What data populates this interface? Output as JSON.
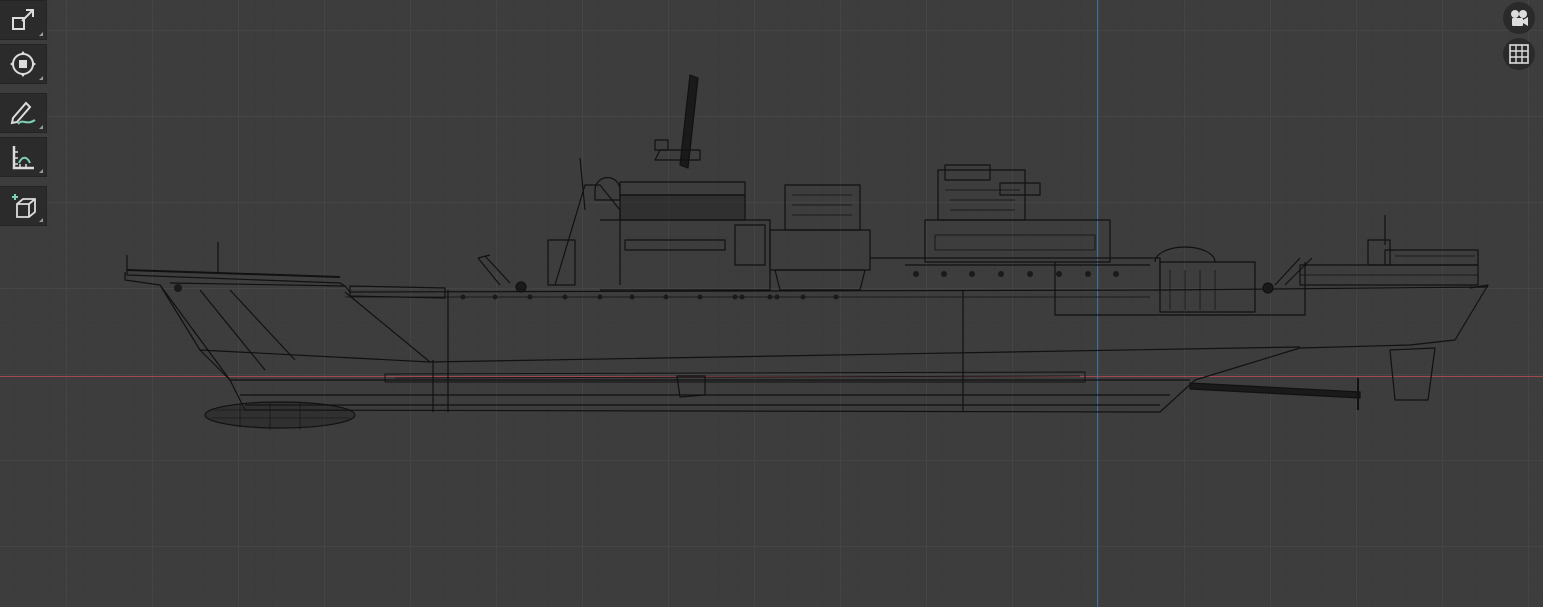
{
  "viewport": {
    "background_color": "#3d3d3d",
    "axis_x_color": "#b44a55",
    "axis_z_color": "#3d74b3",
    "wire_color": "#111111",
    "object": "ship-wireframe-side-view"
  },
  "toolbar": {
    "tools": [
      {
        "name": "scale-tool",
        "icon": "scale-icon"
      },
      {
        "name": "transform-tool",
        "icon": "transform-icon"
      },
      {
        "name": "annotate-tool",
        "icon": "annotate-pencil-icon"
      },
      {
        "name": "measure-tool",
        "icon": "ruler-icon"
      },
      {
        "name": "add-cube-tool",
        "icon": "add-cube-icon"
      }
    ]
  },
  "navigation": {
    "camera": "camera-icon",
    "grid": "grid-icon"
  }
}
